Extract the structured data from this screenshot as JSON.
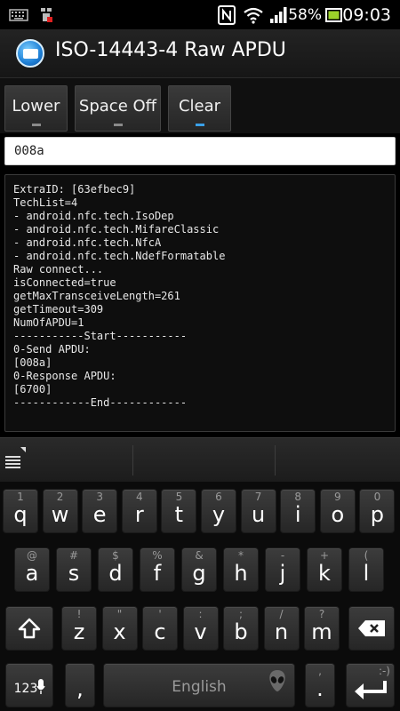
{
  "status_bar": {
    "battery_percent": "58%",
    "time": "09:03",
    "icons": [
      "keyboard-icon",
      "usb-icon",
      "nfc-icon",
      "wifi-icon",
      "signal-icon",
      "battery-icon"
    ]
  },
  "app": {
    "title": "ISO-14443-4 Raw APDU"
  },
  "toolbar": {
    "lower_label": "Lower",
    "space_label": "Space Off",
    "clear_label": "Clear"
  },
  "input": {
    "value": "008a"
  },
  "log_lines": [
    "ExtraID: [63efbec9]",
    "TechList=4",
    "- android.nfc.tech.IsoDep",
    "- android.nfc.tech.MifareClassic",
    "- android.nfc.tech.NfcA",
    "- android.nfc.tech.NdefFormatable",
    "Raw connect...",
    "isConnected=true",
    "getMaxTransceiveLength=261",
    "getTimeout=309",
    "NumOfAPDU=1",
    "-----------Start-----------",
    "0-Send APDU:",
    "[008a]",
    "0-Response APDU:",
    "[6700]",
    "------------End------------"
  ],
  "keyboard": {
    "row1": [
      {
        "main": "q",
        "sup": "1"
      },
      {
        "main": "w",
        "sup": "2"
      },
      {
        "main": "e",
        "sup": "3"
      },
      {
        "main": "r",
        "sup": "4"
      },
      {
        "main": "t",
        "sup": "5"
      },
      {
        "main": "y",
        "sup": "6"
      },
      {
        "main": "u",
        "sup": "7"
      },
      {
        "main": "i",
        "sup": "8"
      },
      {
        "main": "o",
        "sup": "9"
      },
      {
        "main": "p",
        "sup": "0"
      }
    ],
    "row2": [
      {
        "main": "a",
        "sup": "@"
      },
      {
        "main": "s",
        "sup": "#"
      },
      {
        "main": "d",
        "sup": "$"
      },
      {
        "main": "f",
        "sup": "%"
      },
      {
        "main": "g",
        "sup": "&"
      },
      {
        "main": "h",
        "sup": "*"
      },
      {
        "main": "j",
        "sup": "-"
      },
      {
        "main": "k",
        "sup": "+"
      },
      {
        "main": "l",
        "sup": "("
      }
    ],
    "row3": [
      {
        "main": "z",
        "sup": "!"
      },
      {
        "main": "x",
        "sup": "\""
      },
      {
        "main": "c",
        "sup": "'"
      },
      {
        "main": "v",
        "sup": ":"
      },
      {
        "main": "b",
        "sup": ";"
      },
      {
        "main": "n",
        "sup": "/"
      },
      {
        "main": "m",
        "sup": "?"
      }
    ],
    "sym_label": "123",
    "comma": ",",
    "space_label": "English",
    "period": ".",
    "period_sup": ",",
    "enter_sup": ":-)"
  }
}
